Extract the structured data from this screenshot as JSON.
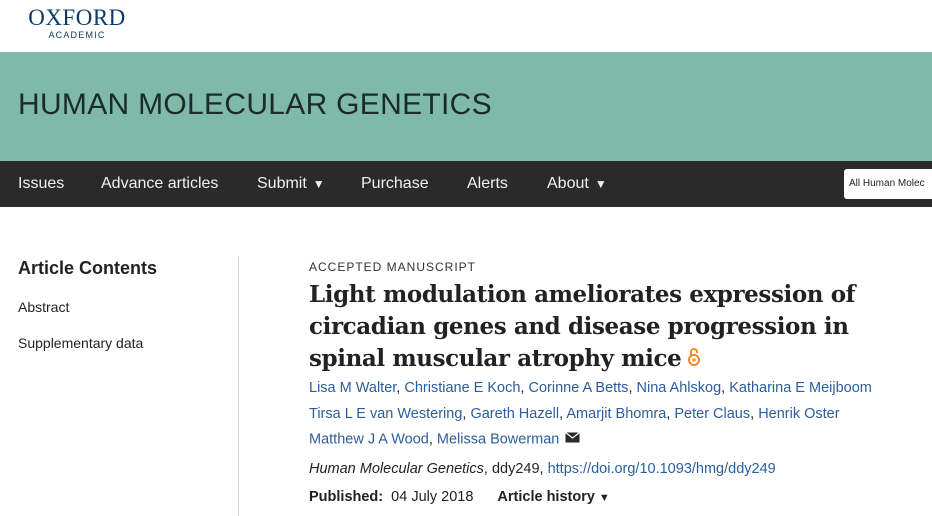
{
  "brand": {
    "logo_main": "OXFORD",
    "logo_sub": "ACADEMIC"
  },
  "journal": {
    "title": "HUMAN MOLECULAR GENETICS"
  },
  "nav": {
    "issues": "Issues",
    "advance_articles": "Advance articles",
    "submit": "Submit",
    "purchase": "Purchase",
    "alerts": "Alerts",
    "about": "About",
    "caret": "▼"
  },
  "search": {
    "scope": "All Human Molec"
  },
  "sidebar": {
    "title": "Article Contents",
    "items": [
      {
        "label": "Abstract"
      },
      {
        "label": "Supplementary data"
      }
    ]
  },
  "article": {
    "eyebrow": "ACCEPTED MANUSCRIPT",
    "title": "Light modulation ameliorates expression of circadian genes and disease progression in spinal muscular atrophy mice",
    "open_access_icon": "open-access-icon",
    "authors": [
      "Lisa M Walter",
      "Christiane E Koch",
      "Corinne A Betts",
      "Nina Ahlskog",
      "Katharina E Meijboom",
      "Tirsa L E van Westering",
      "Gareth Hazell",
      "Amarjit Bhomra",
      "Peter Claus",
      "Henrik Oster",
      "Matthew J A Wood",
      "Melissa Bowerman"
    ],
    "separator": ", ",
    "mail_icon": "envelope-icon",
    "citation": {
      "journal": "Human Molecular Genetics",
      "id": ", ddy249, ",
      "doi": "https://doi.org/10.1093/hmg/ddy249"
    },
    "published_label": "Published:",
    "published_date": "04 July 2018",
    "history_label": "Article history",
    "history_caret": "▼"
  },
  "colors": {
    "banner": "#7fb9a7",
    "navbar": "#2a2a2a",
    "link": "#2a5e9e",
    "open_access": "#f08b2b"
  }
}
